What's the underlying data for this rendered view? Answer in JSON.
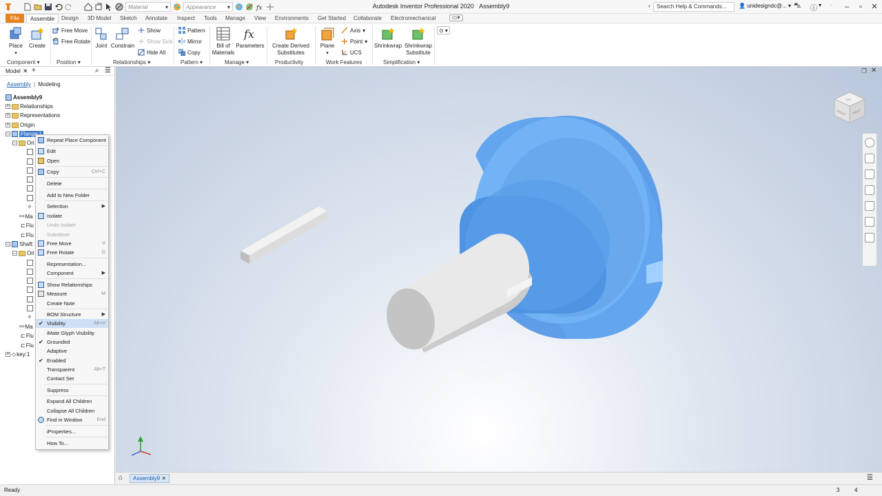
{
  "window": {
    "title": "Autodesk Inventor Professional 2020",
    "document": "Assembly9",
    "search_placeholder": "Search Help & Commands...",
    "user": "unidesigndc@..."
  },
  "quick_access": {
    "material_combo": "Material",
    "appearance_combo": "Appearance"
  },
  "tabs": [
    "File",
    "Assemble",
    "Design",
    "3D Model",
    "Sketch",
    "Annotate",
    "Inspect",
    "Tools",
    "Manage",
    "View",
    "Environments",
    "Get Started",
    "Collaborate",
    "Electromechanical"
  ],
  "ribbon": {
    "component": {
      "label": "Component",
      "place": "Place",
      "create": "Create"
    },
    "position": {
      "label": "Position",
      "free_move": "Free Move",
      "free_rotate": "Free Rotate"
    },
    "relationships": {
      "label": "Relationships",
      "joint": "Joint",
      "constrain": "Constrain",
      "show": "Show",
      "show_sick": "Show Sick",
      "hide_all": "Hide All"
    },
    "pattern": {
      "label": "Pattern",
      "pattern": "Pattern",
      "mirror": "Mirror",
      "copy": "Copy"
    },
    "manage": {
      "label": "Manage",
      "bom_line1": "Bill of",
      "bom_line2": "Materials",
      "parameters": "Parameters"
    },
    "productivity": {
      "label": "Productivity",
      "cds_line1": "Create Derived",
      "cds_line2": "Substitutes"
    },
    "work_features": {
      "label": "Work Features",
      "plane": "Plane",
      "axis": "Axis",
      "point": "Point",
      "ucs": "UCS"
    },
    "simplification": {
      "label": "Simplification",
      "shrinkwrap": "Shrinkwrap",
      "sws_line1": "Shrinkwrap",
      "sws_line2": "Substitute"
    }
  },
  "browser": {
    "title": "Model",
    "tab_assembly": "Assembly",
    "tab_modeling": "Modeling",
    "tree": [
      {
        "label": "Assembly9",
        "bold": true
      },
      {
        "label": "Relationships"
      },
      {
        "label": "Representations"
      },
      {
        "label": "Origin"
      },
      {
        "label": "Flange:1",
        "selected": true
      },
      {
        "label": "Ori"
      },
      {
        "label": "Ma"
      },
      {
        "label": "Flu"
      },
      {
        "label": "Flu"
      },
      {
        "label": "Shaft:"
      },
      {
        "label": "Ori"
      },
      {
        "label": "Ma"
      },
      {
        "label": "Flu"
      },
      {
        "label": "Flu"
      },
      {
        "label": "key:1"
      }
    ]
  },
  "context_menu": [
    {
      "label": "Repeat Place Component",
      "icon": true
    },
    {
      "sep": true
    },
    {
      "label": "Edit",
      "icon": true
    },
    {
      "label": "Open",
      "icon": true
    },
    {
      "sep": true
    },
    {
      "label": "Copy",
      "shortcut": "Ctrl+C",
      "icon": true
    },
    {
      "sep": true
    },
    {
      "label": "Delete"
    },
    {
      "sep": true
    },
    {
      "label": "Add to New Folder"
    },
    {
      "sep": true
    },
    {
      "label": "Selection",
      "submenu": true
    },
    {
      "label": "Isolate",
      "icon": true
    },
    {
      "label": "Undo Isolate",
      "disabled": true
    },
    {
      "label": "Substitute",
      "disabled": true
    },
    {
      "label": "Free Move",
      "shortcut": "V",
      "icon": true
    },
    {
      "label": "Free Rotate",
      "shortcut": "G",
      "icon": true
    },
    {
      "sep": true
    },
    {
      "label": "Representation..."
    },
    {
      "label": "Component",
      "submenu": true
    },
    {
      "sep": true
    },
    {
      "label": "Show Relationships",
      "icon": true
    },
    {
      "label": "Measure",
      "shortcut": "M",
      "icon": true
    },
    {
      "label": "Create Note"
    },
    {
      "sep": true
    },
    {
      "label": "BOM Structure",
      "submenu": true
    },
    {
      "label": "Visibility",
      "shortcut": "Alt+V",
      "checked": true,
      "highlighted": true
    },
    {
      "label": "iMate Glyph Visibility"
    },
    {
      "label": "Grounded",
      "checked": true
    },
    {
      "label": "Adaptive"
    },
    {
      "label": "Enabled",
      "checked": true
    },
    {
      "label": "Transparent",
      "shortcut": "Alt+T"
    },
    {
      "label": "Contact Set"
    },
    {
      "sep": true
    },
    {
      "label": "Suppress"
    },
    {
      "sep": true
    },
    {
      "label": "Expand All Children"
    },
    {
      "label": "Collapse All Children"
    },
    {
      "label": "Find in Window",
      "shortcut": "End",
      "icon": true
    },
    {
      "sep": true
    },
    {
      "label": "iProperties..."
    },
    {
      "sep": true
    },
    {
      "label": "How To..."
    }
  ],
  "viewcube": {
    "front": "FRONT",
    "right": "RIGHT",
    "top": "TOP"
  },
  "document_tab": "Assembly9",
  "status": {
    "text": "Ready",
    "count1": "3",
    "count2": "4"
  },
  "colors": {
    "accent": "#e8821e",
    "part_blue": "#6aaef0",
    "part_grey": "#d2d2d2"
  }
}
